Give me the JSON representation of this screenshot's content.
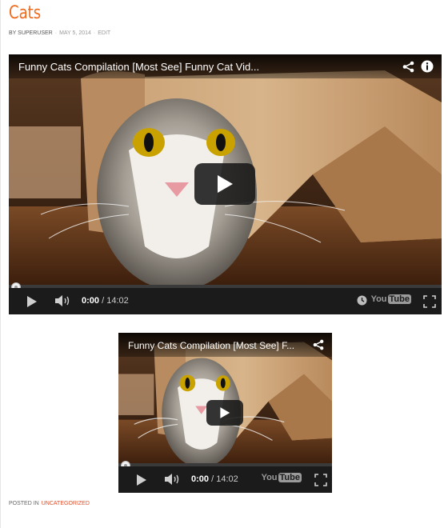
{
  "post": {
    "title": "Cats",
    "author": "BY SUPERUSER",
    "date": "MAY 5, 2014",
    "edit": "EDIT"
  },
  "videos": [
    {
      "title": "Funny Cats Compilation [Most See] Funny Cat Vid...",
      "current_time": "0:00",
      "duration": "/ 14:02",
      "progress": 0
    },
    {
      "title": "Funny Cats Compilation [Most See] F...",
      "current_time": "0:00",
      "duration": "/ 14:02",
      "progress": 0
    }
  ],
  "branding": {
    "you": "You",
    "tube": "Tube"
  },
  "footer": {
    "posted_in": "POSTED IN",
    "category": "UNCATEGORIZED"
  },
  "colors": {
    "accent": "#f06a1a",
    "link": "#e34b24",
    "control_bar": "#1b1b1b"
  }
}
